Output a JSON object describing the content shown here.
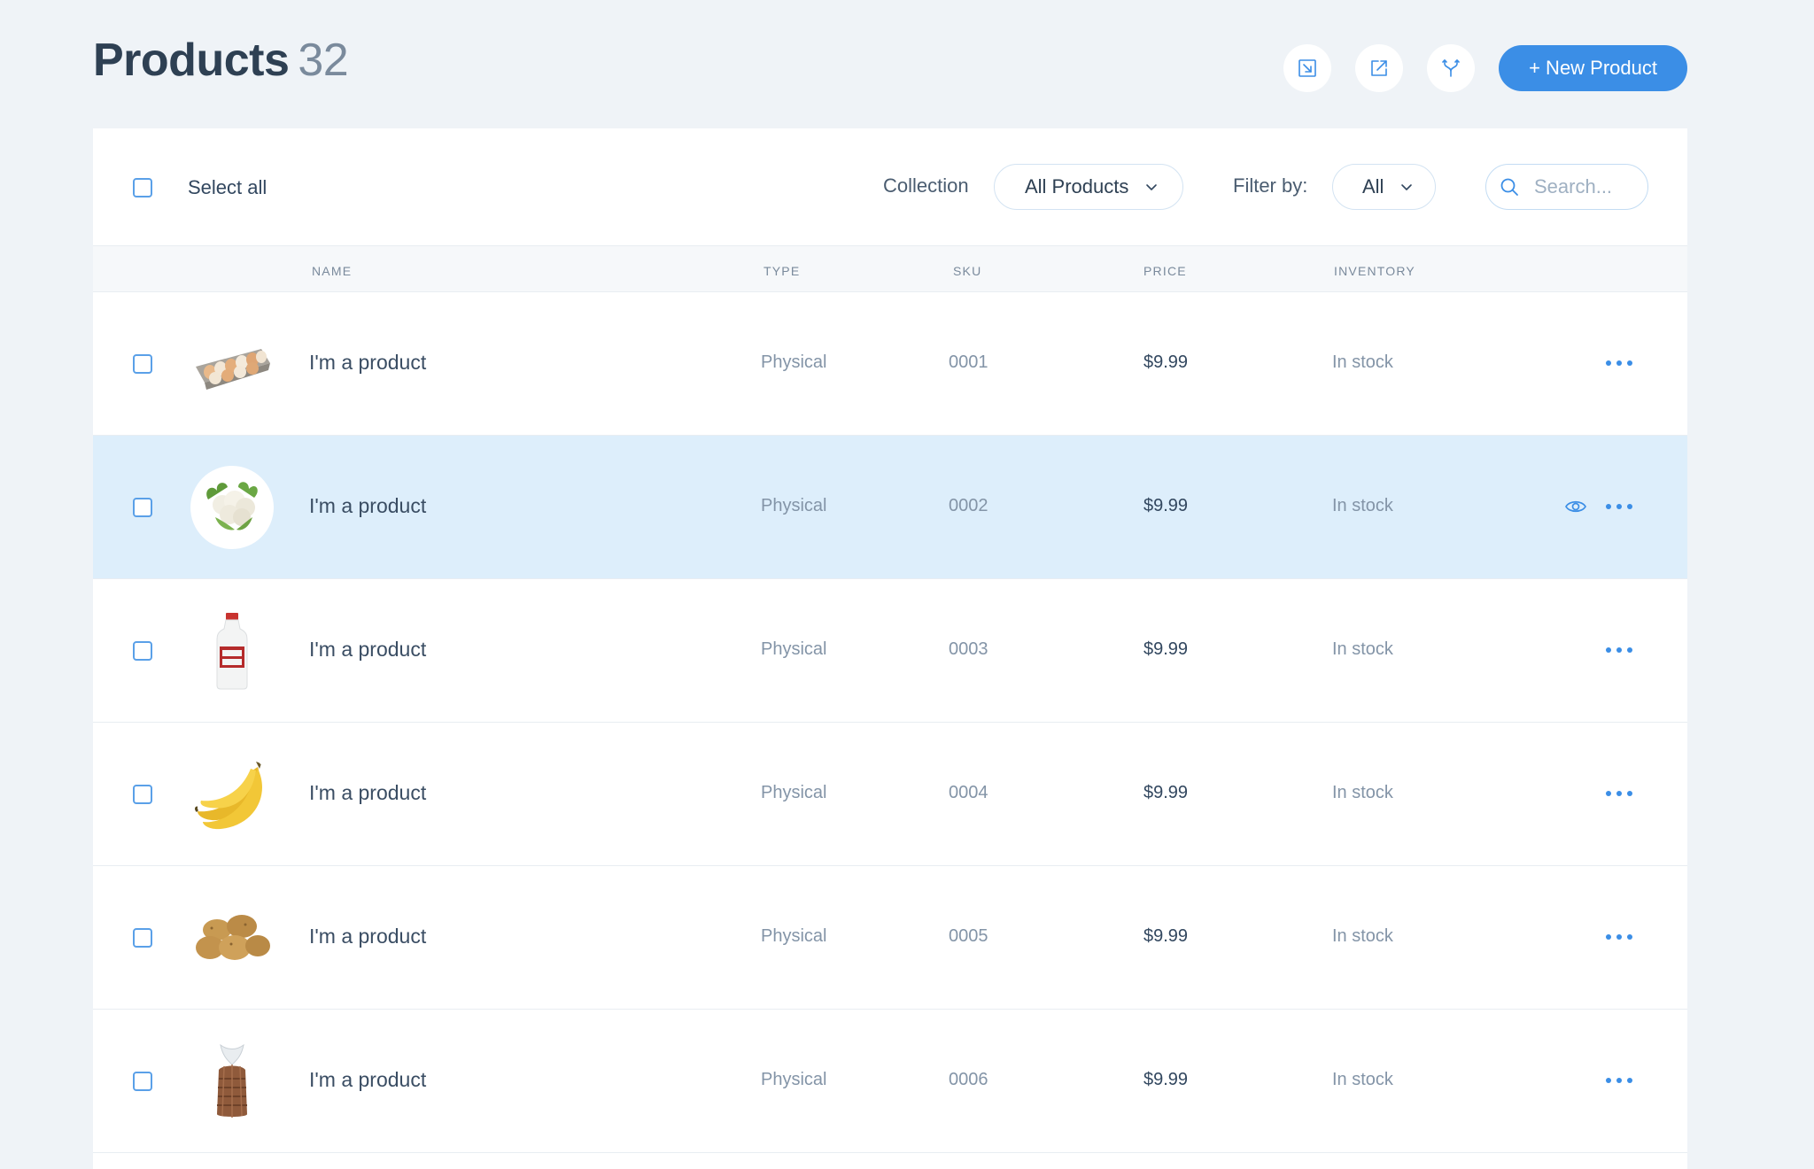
{
  "header": {
    "title": "Products",
    "count": "32",
    "actions": [
      {
        "name": "import-button",
        "icon": "import-icon"
      },
      {
        "name": "export-button",
        "icon": "export-icon"
      },
      {
        "name": "merge-button",
        "icon": "merge-icon"
      }
    ],
    "new_product_label": "+ New Product"
  },
  "toolbar": {
    "select_all_label": "Select all",
    "collection_label": "Collection",
    "collection_value": "All Products",
    "filter_label": "Filter by:",
    "filter_value": "All",
    "search_placeholder": "Search..."
  },
  "table": {
    "columns": [
      "NAME",
      "TYPE",
      "SKU",
      "PRICE",
      "INVENTORY"
    ],
    "rows": [
      {
        "name": "I'm a product",
        "type": "Physical",
        "sku": "0001",
        "price": "$9.99",
        "inventory": "In stock",
        "image": "eggs-carton"
      },
      {
        "name": "I'm a product",
        "type": "Physical",
        "sku": "0002",
        "price": "$9.99",
        "inventory": "In stock",
        "image": "cauliflower"
      },
      {
        "name": "I'm a product",
        "type": "Physical",
        "sku": "0003",
        "price": "$9.99",
        "inventory": "In stock",
        "image": "milk-bottle"
      },
      {
        "name": "I'm a product",
        "type": "Physical",
        "sku": "0004",
        "price": "$9.99",
        "inventory": "In stock",
        "image": "bananas"
      },
      {
        "name": "I'm a product",
        "type": "Physical",
        "sku": "0005",
        "price": "$9.99",
        "inventory": "In stock",
        "image": "potatoes"
      },
      {
        "name": "I'm a product",
        "type": "Physical",
        "sku": "0006",
        "price": "$9.99",
        "inventory": "In stock",
        "image": "bread-loaf"
      }
    ],
    "highlighted_row": 1
  },
  "colors": {
    "accent": "#3b8ee6",
    "background": "#eff3f7",
    "highlight_row": "#ddeefb",
    "title": "#2e4053"
  }
}
